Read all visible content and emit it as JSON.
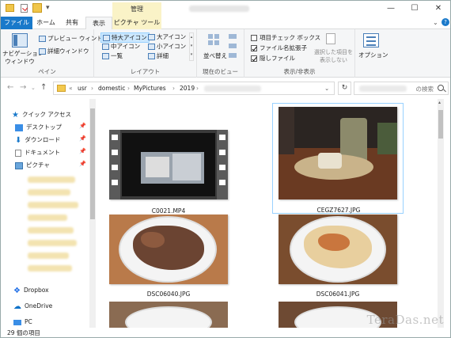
{
  "window": {
    "context_tab_label": "管理",
    "controls": {
      "minimize": "—",
      "maximize": "☐",
      "close": "✕"
    }
  },
  "tabs": [
    {
      "label": "ファイル"
    },
    {
      "label": "ホーム"
    },
    {
      "label": "共有"
    },
    {
      "label": "表示"
    },
    {
      "label": "ピクチャ ツール"
    }
  ],
  "ribbon": {
    "pane": {
      "nav_pane": "ナビゲーション\nウィンドウ",
      "preview": "プレビュー ウィンドウ",
      "details": "詳細ウィンドウ",
      "label": "ペイン"
    },
    "layout": {
      "items": [
        "特大アイコン",
        "大アイコン",
        "中アイコン",
        "小アイコン",
        "一覧",
        "詳細"
      ],
      "label": "レイアウト"
    },
    "current_view": {
      "sort": "並べ替え",
      "label": "現在のビュー"
    },
    "show_hide": {
      "item_checkbox": "項目チェック ボックス",
      "extensions": "ファイル名拡張子",
      "hidden": "隠しファイル",
      "hide_selected": "選択した項目を\n表示しない",
      "label": "表示/非表示"
    },
    "options": {
      "label": "オプション"
    }
  },
  "address": {
    "crumbs": [
      "usr",
      "domestic",
      "MyPictures",
      "2019"
    ],
    "search_placeholder": "の検索"
  },
  "navpane": {
    "quick_access": "クイック アクセス",
    "items": [
      "デスクトップ",
      "ダウンロード",
      "ドキュメント",
      "ピクチャ"
    ],
    "dropbox": "Dropbox",
    "onedrive": "OneDrive",
    "pc": "PC"
  },
  "files": [
    {
      "name": "C0021.MP4"
    },
    {
      "name": "CEGZ7627.JPG"
    },
    {
      "name": "DSC06040.JPG"
    },
    {
      "name": "DSC06041.JPG"
    }
  ],
  "status": {
    "count": "29 個の項目"
  },
  "watermark": "TeraDas.net",
  "colors": {
    "accent": "#1979ca",
    "context_tab": "#faf3c7",
    "selection": "#99d1ff"
  }
}
